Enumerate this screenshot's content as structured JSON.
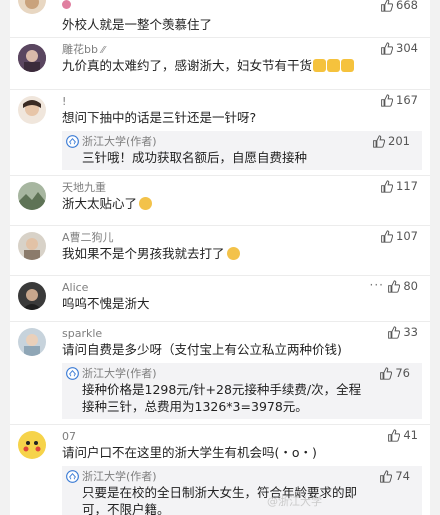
{
  "colors": {
    "background": "#f2f2f2",
    "card": "#ffffff",
    "reply_bg": "#f3f3f5",
    "username": "#7e7e7e",
    "text": "#222222",
    "link_blue": "#3a7bd5"
  },
  "icons": {
    "like": "thumb-up-icon",
    "more": "ellipsis-icon",
    "official": "university-badge-icon"
  },
  "comments": [
    {
      "user": "",
      "text": "外校人就是一整个羡慕住了",
      "likes": "668",
      "reply": null
    },
    {
      "user": "雕花bb",
      "text": "九价真的太难约了，感谢浙大，妇女节有干货",
      "likes": "304",
      "reply": null
    },
    {
      "user": "!",
      "text": "想问下抽中的话是三针还是一针呀?",
      "likes": "167",
      "reply": {
        "user": "浙江大学(作者)",
        "text": "三针哦！成功获取名额后，自愿自费接种",
        "likes": "201"
      }
    },
    {
      "user": "天地九重",
      "text": "浙大太贴心了",
      "likes": "117",
      "reply": null
    },
    {
      "user": "A曹二狗儿",
      "text": "我如果不是个男孩我就去打了",
      "likes": "107",
      "reply": null
    },
    {
      "user": "Alice",
      "text": "呜呜不愧是浙大",
      "likes": "80",
      "more": "···",
      "reply": null
    },
    {
      "user": "sparkle",
      "text": "请问自费是多少呀（支付宝上有公立私立两种价钱)",
      "likes": "33",
      "reply": {
        "user": "浙江大学(作者)",
        "text": "接种价格是1298元/针+28元接种手续费/次，全程接种三针，总费用为1326*3=3978元。",
        "likes": "76"
      }
    },
    {
      "user": "07",
      "text": "请问户口不在这里的浙大学生有机会吗(・o・)",
      "likes": "41",
      "reply": {
        "user": "浙江大学(作者)",
        "text": "只要是在校的全日制浙大女生，符合年龄要求的即可，不限户籍。",
        "likes": "74"
      }
    }
  ],
  "watermark": "@浙江大学"
}
